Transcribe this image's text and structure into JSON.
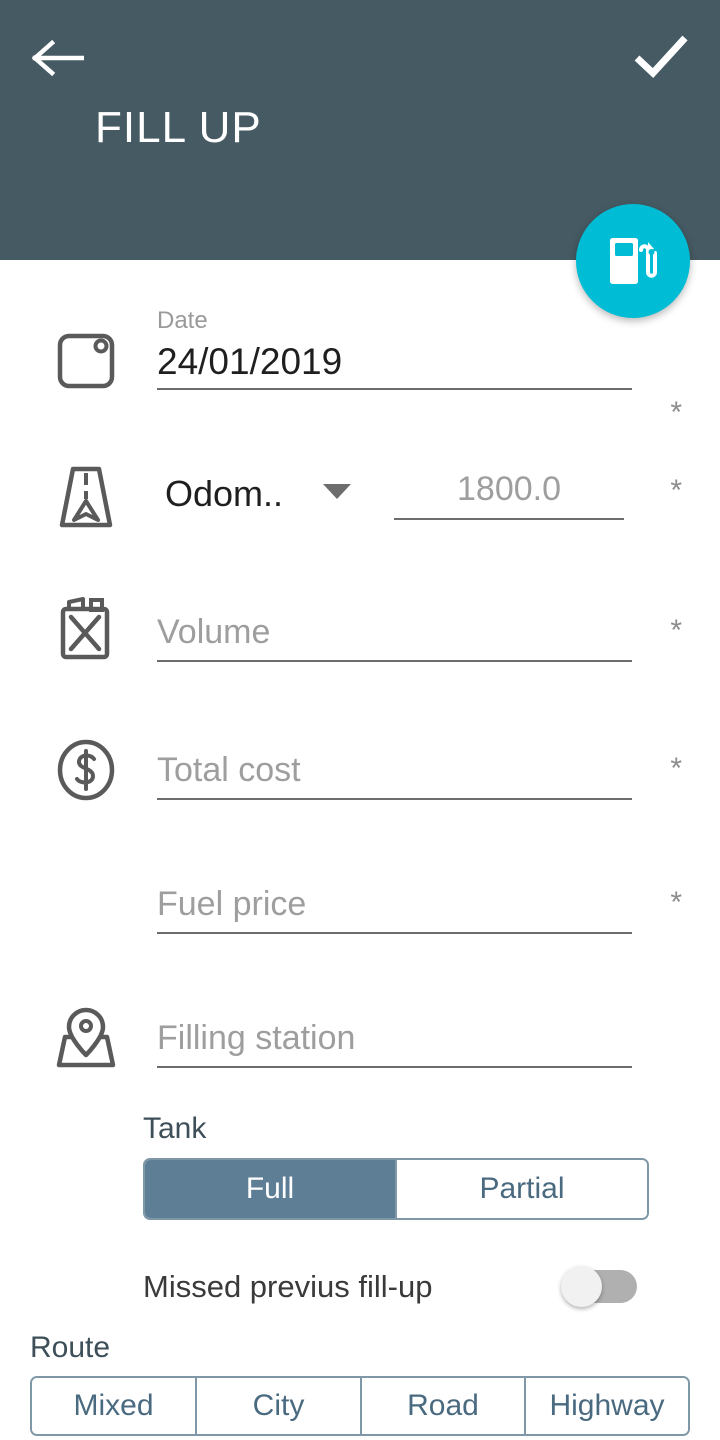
{
  "header": {
    "title": "FILL UP",
    "back_icon": "back-arrow-icon",
    "confirm_icon": "checkmark-icon",
    "bg_color": "#465a63"
  },
  "fab": {
    "icon": "fuel-pump-icon",
    "color": "#00bcd4"
  },
  "form": {
    "required_marker": "*",
    "date": {
      "label": "Date",
      "value": "24/01/2019",
      "icon": "calendar-icon",
      "required": "*"
    },
    "odometer": {
      "selected_type": "Odom..",
      "placeholder": "1800.0",
      "value": "",
      "icon": "road-icon",
      "required": "*",
      "dropdown_icon": "chevron-down-icon"
    },
    "volume": {
      "placeholder": "Volume",
      "value": "",
      "icon": "jerrycan-icon",
      "required": "*"
    },
    "total_cost": {
      "placeholder": "Total cost",
      "value": "",
      "icon": "dollar-circle-icon",
      "required": "*"
    },
    "fuel_price": {
      "placeholder": "Fuel price",
      "value": "",
      "required": "*"
    },
    "filling_station": {
      "placeholder": "Filling station",
      "value": "",
      "icon": "map-pin-icon"
    },
    "tank": {
      "label": "Tank",
      "options": [
        "Full",
        "Partial"
      ],
      "selected": "Full"
    },
    "missed_fillup": {
      "label": "Missed previus fill-up",
      "enabled": false
    },
    "route": {
      "label": "Route",
      "options": [
        "Mixed",
        "City",
        "Road",
        "Highway"
      ],
      "selected": ""
    }
  },
  "colors": {
    "header": "#465a63",
    "accent": "#00bcd4",
    "segment_active": "#5e7e96",
    "segment_border": "#7f98a8"
  }
}
